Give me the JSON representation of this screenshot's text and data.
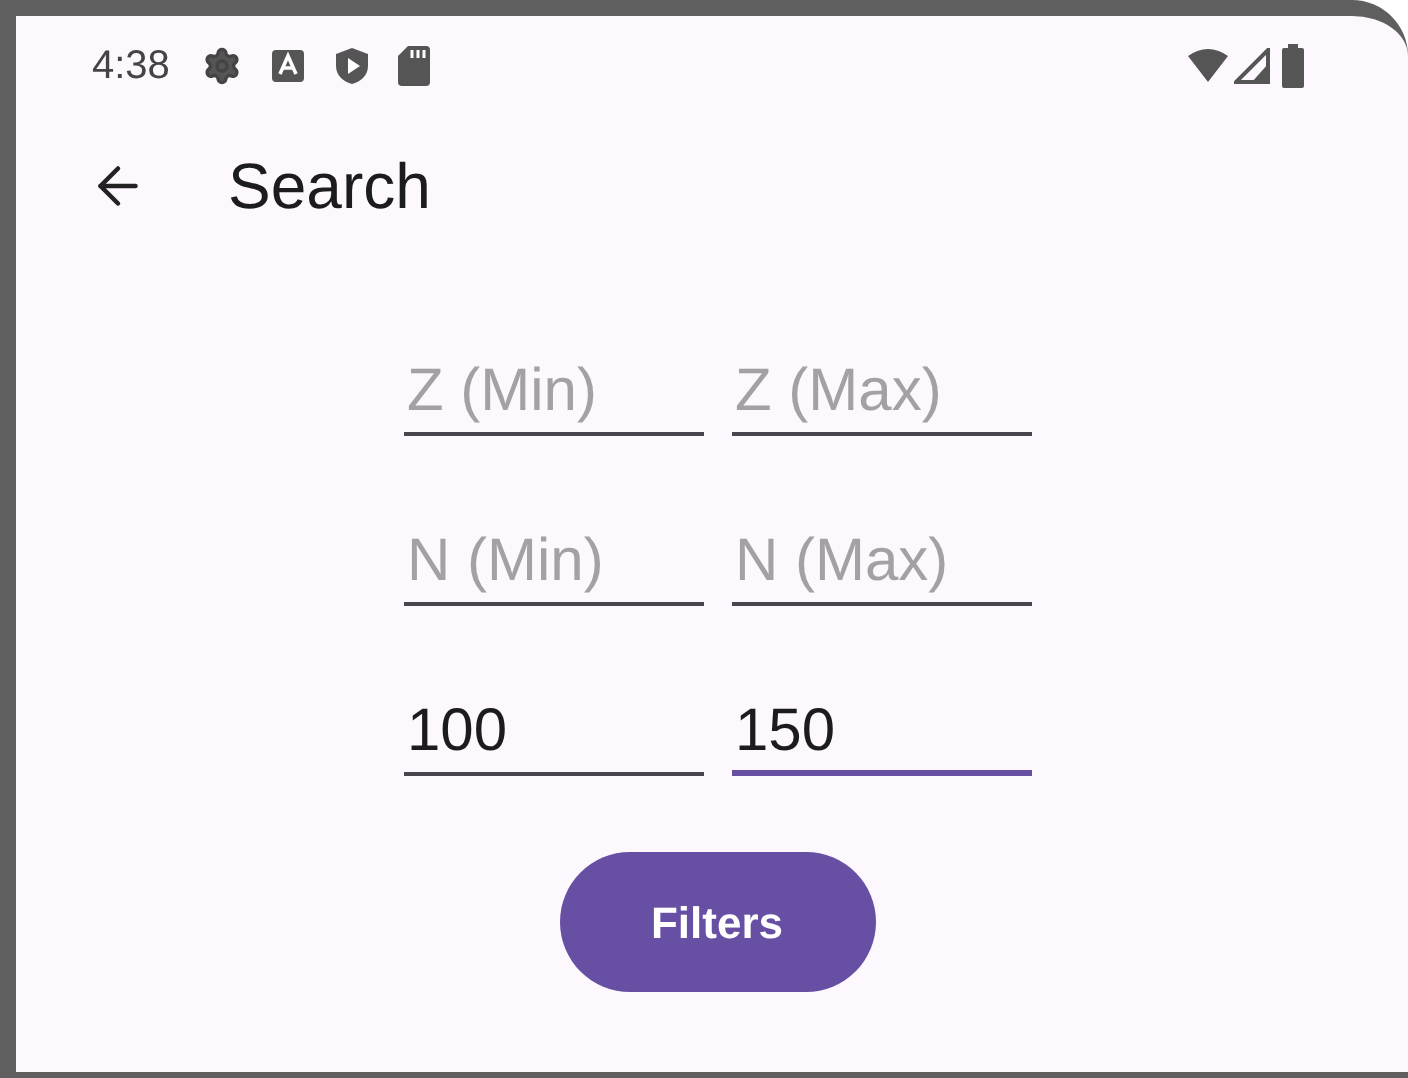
{
  "status_bar": {
    "time": "4:38"
  },
  "app_bar": {
    "title": "Search"
  },
  "fields": [
    {
      "placeholder": "Z (Min)",
      "focused": false
    },
    {
      "placeholder": "Z (Max)",
      "focused": false
    },
    {
      "placeholder": "N (Min)",
      "focused": false
    },
    {
      "placeholder": "N (Max)",
      "focused": false
    },
    {
      "value": "100",
      "focused": false
    },
    {
      "value": "150",
      "focused": true
    }
  ],
  "button": {
    "label": "Filters"
  }
}
